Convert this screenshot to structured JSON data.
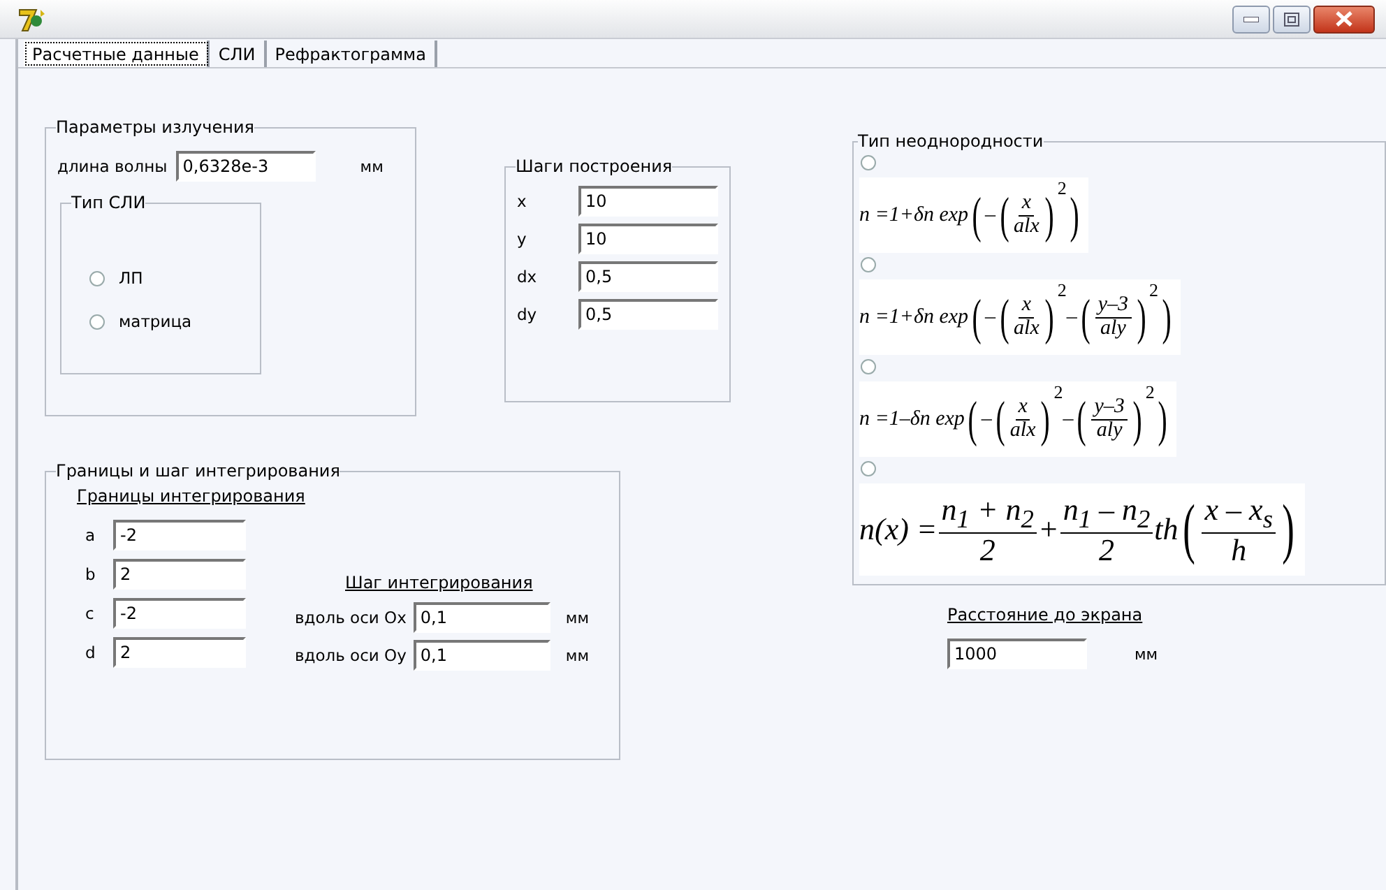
{
  "tabs": [
    {
      "label": "Расчетные данные",
      "selected": true
    },
    {
      "label": "СЛИ",
      "selected": false
    },
    {
      "label": "Рефрактограмма",
      "selected": false
    }
  ],
  "radiation": {
    "title": "Параметры излучения",
    "wavelength": {
      "label": "длина волны",
      "value": "0,6328e-3",
      "unit": "мм"
    },
    "sli_type": {
      "title": "Тип СЛИ",
      "options": [
        {
          "label": "ЛП",
          "selected": false
        },
        {
          "label": "матрица",
          "selected": false
        }
      ]
    }
  },
  "steps": {
    "title": "Шаги построения",
    "fields": [
      {
        "label": "x",
        "value": "10"
      },
      {
        "label": "y",
        "value": "10"
      },
      {
        "label": "dx",
        "value": "0,5"
      },
      {
        "label": "dy",
        "value": "0,5"
      }
    ]
  },
  "integration": {
    "title": "Границы и шаг интегрирования",
    "bounds": {
      "title": "Границы интегрирования",
      "fields": [
        {
          "label": "a",
          "value": "-2"
        },
        {
          "label": "b",
          "value": "2"
        },
        {
          "label": "c",
          "value": "-2"
        },
        {
          "label": "d",
          "value": "2"
        }
      ]
    },
    "step": {
      "title": "Шаг интегрирования",
      "fields": [
        {
          "label": "вдоль оси Ox",
          "value": "0,1",
          "unit": "мм"
        },
        {
          "label": "вдоль оси Oy",
          "value": "0,1",
          "unit": "мм"
        }
      ]
    }
  },
  "inhomogeneity": {
    "title": "Тип неоднородности",
    "options": [
      {
        "selected": false,
        "large": false,
        "formula": [
          {
            "kind": "text",
            "text": "n =1+δn exp"
          },
          {
            "kind": "big",
            "text": "("
          },
          {
            "kind": "text",
            "text": "–"
          },
          {
            "kind": "big",
            "text": "("
          },
          {
            "kind": "frac",
            "num": "x",
            "den": "alx"
          },
          {
            "kind": "big",
            "text": ")"
          },
          {
            "kind": "sup",
            "text": "2"
          },
          {
            "kind": "big",
            "text": ")"
          }
        ]
      },
      {
        "selected": false,
        "large": false,
        "formula": [
          {
            "kind": "text",
            "text": "n =1+δn exp"
          },
          {
            "kind": "big",
            "text": "("
          },
          {
            "kind": "text",
            "text": "–"
          },
          {
            "kind": "big",
            "text": "("
          },
          {
            "kind": "frac",
            "num": "x",
            "den": "alx"
          },
          {
            "kind": "big",
            "text": ")"
          },
          {
            "kind": "sup",
            "text": "2"
          },
          {
            "kind": "text",
            "text": "–"
          },
          {
            "kind": "big",
            "text": "("
          },
          {
            "kind": "frac",
            "num": "y–3",
            "den": "aly"
          },
          {
            "kind": "big",
            "text": ")"
          },
          {
            "kind": "sup",
            "text": "2"
          },
          {
            "kind": "big",
            "text": ")"
          }
        ]
      },
      {
        "selected": false,
        "large": false,
        "formula": [
          {
            "kind": "text",
            "text": "n =1–δn exp"
          },
          {
            "kind": "big",
            "text": "("
          },
          {
            "kind": "text",
            "text": "–"
          },
          {
            "kind": "big",
            "text": "("
          },
          {
            "kind": "frac",
            "num": "x",
            "den": "alx"
          },
          {
            "kind": "big",
            "text": ")"
          },
          {
            "kind": "sup",
            "text": "2"
          },
          {
            "kind": "text",
            "text": "–"
          },
          {
            "kind": "big",
            "text": "("
          },
          {
            "kind": "frac",
            "num": "y–3",
            "den": "aly"
          },
          {
            "kind": "big",
            "text": ")"
          },
          {
            "kind": "sup",
            "text": "2"
          },
          {
            "kind": "big",
            "text": ")"
          }
        ]
      },
      {
        "selected": false,
        "large": true,
        "formula": [
          {
            "kind": "text",
            "text": "n(x) ="
          },
          {
            "kind": "frac",
            "num": "n$_{1}$ + n$_{2}$",
            "den": "2"
          },
          {
            "kind": "text",
            "text": "+"
          },
          {
            "kind": "frac",
            "num": "n$_{1}$ – n$_{2}$",
            "den": "2"
          },
          {
            "kind": "text",
            "text": "th"
          },
          {
            "kind": "big",
            "text": "("
          },
          {
            "kind": "frac",
            "num": "x – x$_{s}$",
            "den": "h"
          },
          {
            "kind": "big",
            "text": ")"
          }
        ]
      }
    ]
  },
  "distance": {
    "label": "Расстояние до экрана",
    "value": "1000",
    "unit": "мм"
  }
}
